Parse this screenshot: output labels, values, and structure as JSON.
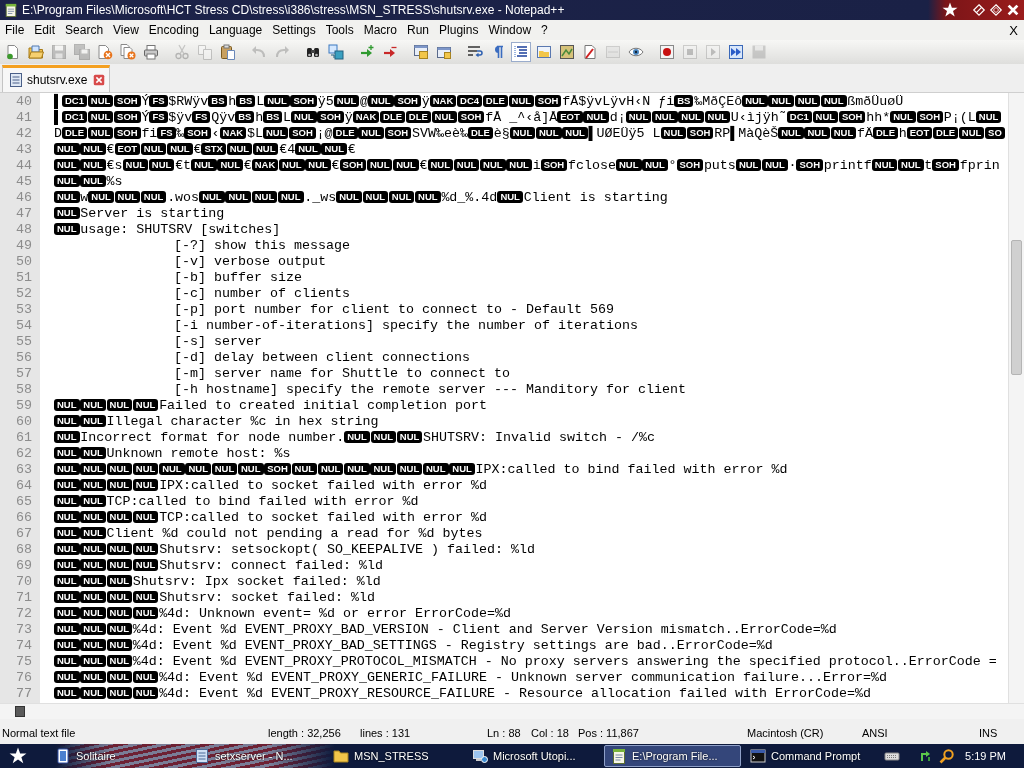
{
  "window": {
    "title": "E:\\Program Files\\Microsoft\\HCT Stress CD\\stress\\i386\\stress\\MSN_STRESS\\shutsrv.exe - Notepad++"
  },
  "menu": {
    "items": [
      "File",
      "Edit",
      "Search",
      "View",
      "Encoding",
      "Language",
      "Settings",
      "Tools",
      "Macro",
      "Run",
      "Plugins",
      "Window",
      "?"
    ],
    "close_document": "X"
  },
  "toolbar": [
    {
      "disabled": false,
      "pressed": false
    },
    {
      "disabled": false,
      "pressed": false
    },
    {
      "disabled": true,
      "pressed": false
    },
    {
      "disabled": true,
      "pressed": false
    },
    {
      "disabled": false,
      "pressed": false
    },
    {
      "disabled": false,
      "pressed": false
    },
    {
      "disabled": false,
      "pressed": false
    },
    {
      "disabled": true,
      "pressed": false
    },
    {
      "disabled": true,
      "pressed": false
    },
    {
      "disabled": false,
      "pressed": false
    },
    {
      "disabled": true,
      "pressed": false
    },
    {
      "disabled": true,
      "pressed": false
    },
    {
      "disabled": false,
      "pressed": false
    },
    {
      "disabled": false,
      "pressed": false
    },
    {
      "disabled": false,
      "pressed": false
    },
    {
      "disabled": false,
      "pressed": false
    },
    {
      "disabled": false,
      "pressed": false
    },
    {
      "disabled": false,
      "pressed": false
    },
    {
      "disabled": false,
      "pressed": false
    },
    {
      "disabled": false,
      "pressed": false
    },
    {
      "disabled": false,
      "pressed": true
    },
    {
      "disabled": false,
      "pressed": false
    },
    {
      "disabled": false,
      "pressed": false
    },
    {
      "disabled": false,
      "pressed": false
    },
    {
      "disabled": true,
      "pressed": false
    },
    {
      "disabled": false,
      "pressed": false
    },
    {
      "disabled": false,
      "pressed": false
    },
    {
      "disabled": true,
      "pressed": false
    },
    {
      "disabled": true,
      "pressed": false
    },
    {
      "disabled": false,
      "pressed": false
    },
    {
      "disabled": true,
      "pressed": false
    }
  ],
  "tabs": [
    {
      "label": "shutsrv.exe",
      "selected": true
    }
  ],
  "editor": {
    "lines": [
      {
        "number": "40",
        "segments": [
          {
            "kind": "text",
            "text": "▌"
          },
          {
            "kind": "ctrl",
            "text": "DC1"
          },
          {
            "kind": "ctrl",
            "text": "NUL"
          },
          {
            "kind": "ctrl",
            "text": "SOH"
          },
          {
            "kind": "text",
            "text": "Ý"
          },
          {
            "kind": "ctrl",
            "text": "FS"
          },
          {
            "kind": "text",
            "text": "$RWÿv"
          },
          {
            "kind": "ctrl",
            "text": "BS"
          },
          {
            "kind": "text",
            "text": "h"
          },
          {
            "kind": "ctrl",
            "text": "BS"
          },
          {
            "kind": "text",
            "text": "L"
          },
          {
            "kind": "ctrl",
            "text": "NUL"
          },
          {
            "kind": "ctrl",
            "text": "SOH"
          },
          {
            "kind": "text",
            "text": "ÿ5"
          },
          {
            "kind": "ctrl",
            "text": "NUL"
          },
          {
            "kind": "text",
            "text": "@"
          },
          {
            "kind": "ctrl",
            "text": "NUL"
          },
          {
            "kind": "ctrl",
            "text": "SOH"
          },
          {
            "kind": "text",
            "text": "ÿ"
          },
          {
            "kind": "ctrl",
            "text": "NAK"
          },
          {
            "kind": "ctrl",
            "text": "DC4"
          },
          {
            "kind": "ctrl",
            "text": "DLE"
          },
          {
            "kind": "ctrl",
            "text": "NUL"
          },
          {
            "kind": "ctrl",
            "text": "SOH"
          },
          {
            "kind": "text",
            "text": "fÅ$ÿvLÿvH‹N ƒi"
          },
          {
            "kind": "ctrl",
            "text": "BS"
          },
          {
            "kind": "text",
            "text": "‰MðÇEô"
          },
          {
            "kind": "ctrl",
            "text": "NUL"
          },
          {
            "kind": "ctrl",
            "text": "NUL"
          },
          {
            "kind": "ctrl",
            "text": "NUL"
          },
          {
            "kind": "ctrl",
            "text": "NUL"
          },
          {
            "kind": "text",
            "text": "ßmðÜuøÜ"
          }
        ]
      },
      {
        "number": "41",
        "segments": [
          {
            "kind": "text",
            "text": "▌"
          },
          {
            "kind": "ctrl",
            "text": "DC1"
          },
          {
            "kind": "ctrl",
            "text": "NUL"
          },
          {
            "kind": "ctrl",
            "text": "SOH"
          },
          {
            "kind": "text",
            "text": "Ý"
          },
          {
            "kind": "ctrl",
            "text": "FS"
          },
          {
            "kind": "text",
            "text": "$ÿv"
          },
          {
            "kind": "ctrl",
            "text": "FS"
          },
          {
            "kind": "text",
            "text": "Qÿv"
          },
          {
            "kind": "ctrl",
            "text": "BS"
          },
          {
            "kind": "text",
            "text": "h"
          },
          {
            "kind": "ctrl",
            "text": "BS"
          },
          {
            "kind": "text",
            "text": "L"
          },
          {
            "kind": "ctrl",
            "text": "NUL"
          },
          {
            "kind": "ctrl",
            "text": "SOH"
          },
          {
            "kind": "text",
            "text": "ÿ"
          },
          {
            "kind": "ctrl",
            "text": "NAK"
          },
          {
            "kind": "ctrl",
            "text": "DLE"
          },
          {
            "kind": "ctrl",
            "text": "DLE"
          },
          {
            "kind": "ctrl",
            "text": "NUL"
          },
          {
            "kind": "ctrl",
            "text": "SOH"
          },
          {
            "kind": "text",
            "text": "fÅ _^‹å]Å"
          },
          {
            "kind": "ctrl",
            "text": "EOT"
          },
          {
            "kind": "ctrl",
            "text": "NUL"
          },
          {
            "kind": "text",
            "text": "d¡"
          },
          {
            "kind": "ctrl",
            "text": "NUL"
          },
          {
            "kind": "ctrl",
            "text": "NUL"
          },
          {
            "kind": "ctrl",
            "text": "NUL"
          },
          {
            "kind": "ctrl",
            "text": "NUL"
          },
          {
            "kind": "text",
            "text": "U‹ìjÿh˜"
          },
          {
            "kind": "ctrl",
            "text": "DC1"
          },
          {
            "kind": "ctrl",
            "text": "NUL"
          },
          {
            "kind": "ctrl",
            "text": "SOH"
          },
          {
            "kind": "text",
            "text": "hh*"
          },
          {
            "kind": "ctrl",
            "text": "NUL"
          },
          {
            "kind": "ctrl",
            "text": "SOH"
          },
          {
            "kind": "text",
            "text": "P¡(L"
          },
          {
            "kind": "ctrl",
            "text": "NUL"
          }
        ]
      },
      {
        "number": "42",
        "segments": [
          {
            "kind": "text",
            "text": "D"
          },
          {
            "kind": "ctrl",
            "text": "DLE"
          },
          {
            "kind": "ctrl",
            "text": "NUL"
          },
          {
            "kind": "ctrl",
            "text": "SOH"
          },
          {
            "kind": "text",
            "text": "fi"
          },
          {
            "kind": "ctrl",
            "text": "FS"
          },
          {
            "kind": "text",
            "text": "‰"
          },
          {
            "kind": "ctrl",
            "text": "SOH"
          },
          {
            "kind": "text",
            "text": "‹"
          },
          {
            "kind": "ctrl",
            "text": "NAK"
          },
          {
            "kind": "text",
            "text": "$L"
          },
          {
            "kind": "ctrl",
            "text": "NUL"
          },
          {
            "kind": "ctrl",
            "text": "SOH"
          },
          {
            "kind": "text",
            "text": "¡@"
          },
          {
            "kind": "ctrl",
            "text": "DLE"
          },
          {
            "kind": "ctrl",
            "text": "NUL"
          },
          {
            "kind": "ctrl",
            "text": "SOH"
          },
          {
            "kind": "text",
            "text": "SVW‰eè‰"
          },
          {
            "kind": "ctrl",
            "text": "DLE"
          },
          {
            "kind": "text",
            "text": "è§"
          },
          {
            "kind": "ctrl",
            "text": "NUL"
          },
          {
            "kind": "ctrl",
            "text": "NUL"
          },
          {
            "kind": "ctrl",
            "text": "NUL"
          },
          {
            "kind": "text",
            "text": "▌UØEÜÿ5 L"
          },
          {
            "kind": "ctrl",
            "text": "NUL"
          },
          {
            "kind": "ctrl",
            "text": "SOH"
          },
          {
            "kind": "text",
            "text": "RP▌MàQèŠ"
          },
          {
            "kind": "ctrl",
            "text": "NUL"
          },
          {
            "kind": "ctrl",
            "text": "NUL"
          },
          {
            "kind": "ctrl",
            "text": "NUL"
          },
          {
            "kind": "text",
            "text": "fÄ"
          },
          {
            "kind": "ctrl",
            "text": "DLE"
          },
          {
            "kind": "text",
            "text": "h"
          },
          {
            "kind": "ctrl",
            "text": "EOT"
          },
          {
            "kind": "ctrl",
            "text": "DLE"
          },
          {
            "kind": "ctrl",
            "text": "NUL"
          },
          {
            "kind": "ctrl",
            "text": "SO"
          }
        ]
      },
      {
        "number": "43",
        "segments": [
          {
            "kind": "ctrl",
            "text": "NUL"
          },
          {
            "kind": "ctrl",
            "text": "NUL"
          },
          {
            "kind": "text",
            "text": "€"
          },
          {
            "kind": "ctrl",
            "text": "EOT"
          },
          {
            "kind": "ctrl",
            "text": "NUL"
          },
          {
            "kind": "ctrl",
            "text": "NUL"
          },
          {
            "kind": "text",
            "text": "€"
          },
          {
            "kind": "ctrl",
            "text": "STX"
          },
          {
            "kind": "ctrl",
            "text": "NUL"
          },
          {
            "kind": "ctrl",
            "text": "NUL"
          },
          {
            "kind": "text",
            "text": "€4"
          },
          {
            "kind": "ctrl",
            "text": "NUL"
          },
          {
            "kind": "ctrl",
            "text": "NUL"
          },
          {
            "kind": "text",
            "text": "€"
          }
        ]
      },
      {
        "number": "44",
        "segments": [
          {
            "kind": "ctrl",
            "text": "NUL"
          },
          {
            "kind": "ctrl",
            "text": "NUL"
          },
          {
            "kind": "text",
            "text": "€s"
          },
          {
            "kind": "ctrl",
            "text": "NUL"
          },
          {
            "kind": "ctrl",
            "text": "NUL"
          },
          {
            "kind": "text",
            "text": "€t"
          },
          {
            "kind": "ctrl",
            "text": "NUL"
          },
          {
            "kind": "ctrl",
            "text": "NUL"
          },
          {
            "kind": "text",
            "text": "€"
          },
          {
            "kind": "ctrl",
            "text": "NAK"
          },
          {
            "kind": "ctrl",
            "text": "NUL"
          },
          {
            "kind": "ctrl",
            "text": "NUL"
          },
          {
            "kind": "text",
            "text": "€"
          },
          {
            "kind": "ctrl",
            "text": "SOH"
          },
          {
            "kind": "ctrl",
            "text": "NUL"
          },
          {
            "kind": "ctrl",
            "text": "NUL"
          },
          {
            "kind": "text",
            "text": "€"
          },
          {
            "kind": "ctrl",
            "text": "NUL"
          },
          {
            "kind": "ctrl",
            "text": "NUL"
          },
          {
            "kind": "ctrl",
            "text": "NUL"
          },
          {
            "kind": "ctrl",
            "text": "NUL"
          },
          {
            "kind": "text",
            "text": "i"
          },
          {
            "kind": "ctrl",
            "text": "SOH"
          },
          {
            "kind": "text",
            "text": "fclose"
          },
          {
            "kind": "ctrl",
            "text": "NUL"
          },
          {
            "kind": "ctrl",
            "text": "NUL"
          },
          {
            "kind": "text",
            "text": "°"
          },
          {
            "kind": "ctrl",
            "text": "SOH"
          },
          {
            "kind": "text",
            "text": "puts"
          },
          {
            "kind": "ctrl",
            "text": "NUL"
          },
          {
            "kind": "ctrl",
            "text": "NUL"
          },
          {
            "kind": "text",
            "text": "·"
          },
          {
            "kind": "ctrl",
            "text": "SOH"
          },
          {
            "kind": "text",
            "text": "printf"
          },
          {
            "kind": "ctrl",
            "text": "NUL"
          },
          {
            "kind": "ctrl",
            "text": "NUL"
          },
          {
            "kind": "text",
            "text": "t"
          },
          {
            "kind": "ctrl",
            "text": "SOH"
          },
          {
            "kind": "text",
            "text": "fprin"
          }
        ]
      },
      {
        "number": "45",
        "segments": [
          {
            "kind": "ctrl",
            "text": "NUL"
          },
          {
            "kind": "ctrl",
            "text": "NUL"
          },
          {
            "kind": "text",
            "text": "%s"
          }
        ]
      },
      {
        "number": "46",
        "segments": [
          {
            "kind": "ctrl",
            "text": "NUL"
          },
          {
            "kind": "text",
            "text": "w"
          },
          {
            "kind": "ctrl",
            "text": "NUL"
          },
          {
            "kind": "ctrl",
            "text": "NUL"
          },
          {
            "kind": "ctrl",
            "text": "NUL"
          },
          {
            "kind": "text",
            "text": ".wos"
          },
          {
            "kind": "ctrl",
            "text": "NUL"
          },
          {
            "kind": "ctrl",
            "text": "NUL"
          },
          {
            "kind": "ctrl",
            "text": "NUL"
          },
          {
            "kind": "ctrl",
            "text": "NUL"
          },
          {
            "kind": "text",
            "text": "._ws"
          },
          {
            "kind": "ctrl",
            "text": "NUL"
          },
          {
            "kind": "ctrl",
            "text": "NUL"
          },
          {
            "kind": "ctrl",
            "text": "NUL"
          },
          {
            "kind": "ctrl",
            "text": "NUL"
          },
          {
            "kind": "text",
            "text": "%d_%.4d"
          },
          {
            "kind": "ctrl",
            "text": "NUL"
          },
          {
            "kind": "text",
            "text": "Client is starting"
          }
        ]
      },
      {
        "number": "47",
        "segments": [
          {
            "kind": "ctrl",
            "text": "NUL"
          },
          {
            "kind": "text",
            "text": "Server is starting"
          }
        ]
      },
      {
        "number": "48",
        "segments": [
          {
            "kind": "ctrl",
            "text": "NUL"
          },
          {
            "kind": "text",
            "text": "usage: SHUTSRV [switches]"
          }
        ]
      },
      {
        "number": "49",
        "segments": [
          {
            "kind": "text",
            "text": "\t\t[-?] show this message"
          }
        ]
      },
      {
        "number": "50",
        "segments": [
          {
            "kind": "text",
            "text": "\t\t[-v] verbose output"
          }
        ]
      },
      {
        "number": "51",
        "segments": [
          {
            "kind": "text",
            "text": "\t\t[-b] buffer size"
          }
        ]
      },
      {
        "number": "52",
        "segments": [
          {
            "kind": "text",
            "text": "\t\t[-c] number of clients"
          }
        ]
      },
      {
        "number": "53",
        "segments": [
          {
            "kind": "text",
            "text": "\t\t[-p] port number for client to connect to - Default 569"
          }
        ]
      },
      {
        "number": "54",
        "segments": [
          {
            "kind": "text",
            "text": "\t\t[-i number-of-iterations] specify the number of iterations"
          }
        ]
      },
      {
        "number": "55",
        "segments": [
          {
            "kind": "text",
            "text": "\t\t[-s] server"
          }
        ]
      },
      {
        "number": "56",
        "segments": [
          {
            "kind": "text",
            "text": "\t\t[-d] delay between client connections"
          }
        ]
      },
      {
        "number": "57",
        "segments": [
          {
            "kind": "text",
            "text": "\t\t[-m] server name for Shuttle to connect to"
          }
        ]
      },
      {
        "number": "58",
        "segments": [
          {
            "kind": "text",
            "text": "\t\t[-h hostname] specify the remote server --- Manditory for client"
          }
        ]
      },
      {
        "number": "59",
        "segments": [
          {
            "kind": "ctrl",
            "text": "NUL"
          },
          {
            "kind": "ctrl",
            "text": "NUL"
          },
          {
            "kind": "ctrl",
            "text": "NUL"
          },
          {
            "kind": "ctrl",
            "text": "NUL"
          },
          {
            "kind": "text",
            "text": "Failed to created initial completion port"
          }
        ]
      },
      {
        "number": "60",
        "segments": [
          {
            "kind": "ctrl",
            "text": "NUL"
          },
          {
            "kind": "ctrl",
            "text": "NUL"
          },
          {
            "kind": "text",
            "text": "Illegal character %c in hex string"
          }
        ]
      },
      {
        "number": "61",
        "segments": [
          {
            "kind": "ctrl",
            "text": "NUL"
          },
          {
            "kind": "text",
            "text": "Incorrect format for node number."
          },
          {
            "kind": "ctrl",
            "text": "NUL"
          },
          {
            "kind": "ctrl",
            "text": "NUL"
          },
          {
            "kind": "ctrl",
            "text": "NUL"
          },
          {
            "kind": "text",
            "text": "SHUTSRV: Invalid switch - /%c"
          }
        ]
      },
      {
        "number": "62",
        "segments": [
          {
            "kind": "ctrl",
            "text": "NUL"
          },
          {
            "kind": "ctrl",
            "text": "NUL"
          },
          {
            "kind": "text",
            "text": "Unknown remote host: %s"
          }
        ]
      },
      {
        "number": "63",
        "segments": [
          {
            "kind": "ctrl",
            "text": "NUL"
          },
          {
            "kind": "ctrl",
            "text": "NUL"
          },
          {
            "kind": "ctrl",
            "text": "NUL"
          },
          {
            "kind": "ctrl",
            "text": "NUL"
          },
          {
            "kind": "ctrl",
            "text": "NUL"
          },
          {
            "kind": "ctrl",
            "text": "NUL"
          },
          {
            "kind": "ctrl",
            "text": "NUL"
          },
          {
            "kind": "ctrl",
            "text": "NUL"
          },
          {
            "kind": "ctrl",
            "text": "SOH"
          },
          {
            "kind": "ctrl",
            "text": "NUL"
          },
          {
            "kind": "ctrl",
            "text": "NUL"
          },
          {
            "kind": "ctrl",
            "text": "NUL"
          },
          {
            "kind": "ctrl",
            "text": "NUL"
          },
          {
            "kind": "ctrl",
            "text": "NUL"
          },
          {
            "kind": "ctrl",
            "text": "NUL"
          },
          {
            "kind": "ctrl",
            "text": "NUL"
          },
          {
            "kind": "text",
            "text": "IPX:called to bind failed with error %d"
          }
        ]
      },
      {
        "number": "64",
        "segments": [
          {
            "kind": "ctrl",
            "text": "NUL"
          },
          {
            "kind": "ctrl",
            "text": "NUL"
          },
          {
            "kind": "ctrl",
            "text": "NUL"
          },
          {
            "kind": "ctrl",
            "text": "NUL"
          },
          {
            "kind": "text",
            "text": "IPX:called to socket failed with error %d"
          }
        ]
      },
      {
        "number": "65",
        "segments": [
          {
            "kind": "ctrl",
            "text": "NUL"
          },
          {
            "kind": "ctrl",
            "text": "NUL"
          },
          {
            "kind": "text",
            "text": "TCP:called to bind failed with error %d"
          }
        ]
      },
      {
        "number": "66",
        "segments": [
          {
            "kind": "ctrl",
            "text": "NUL"
          },
          {
            "kind": "ctrl",
            "text": "NUL"
          },
          {
            "kind": "ctrl",
            "text": "NUL"
          },
          {
            "kind": "ctrl",
            "text": "NUL"
          },
          {
            "kind": "text",
            "text": "TCP:called to socket failed with error %d"
          }
        ]
      },
      {
        "number": "67",
        "segments": [
          {
            "kind": "ctrl",
            "text": "NUL"
          },
          {
            "kind": "ctrl",
            "text": "NUL"
          },
          {
            "kind": "text",
            "text": "Client %d could not pending a read for %d bytes"
          }
        ]
      },
      {
        "number": "68",
        "segments": [
          {
            "kind": "ctrl",
            "text": "NUL"
          },
          {
            "kind": "ctrl",
            "text": "NUL"
          },
          {
            "kind": "ctrl",
            "text": "NUL"
          },
          {
            "kind": "ctrl",
            "text": "NUL"
          },
          {
            "kind": "text",
            "text": "Shutsrv: setsockopt( SO_KEEPALIVE ) failed: %ld"
          }
        ]
      },
      {
        "number": "69",
        "segments": [
          {
            "kind": "ctrl",
            "text": "NUL"
          },
          {
            "kind": "ctrl",
            "text": "NUL"
          },
          {
            "kind": "ctrl",
            "text": "NUL"
          },
          {
            "kind": "ctrl",
            "text": "NUL"
          },
          {
            "kind": "text",
            "text": "Shutsrv: connect failed: %ld"
          }
        ]
      },
      {
        "number": "70",
        "segments": [
          {
            "kind": "ctrl",
            "text": "NUL"
          },
          {
            "kind": "ctrl",
            "text": "NUL"
          },
          {
            "kind": "ctrl",
            "text": "NUL"
          },
          {
            "kind": "text",
            "text": "Shutsrv: Ipx socket failed: %ld"
          }
        ]
      },
      {
        "number": "71",
        "segments": [
          {
            "kind": "ctrl",
            "text": "NUL"
          },
          {
            "kind": "ctrl",
            "text": "NUL"
          },
          {
            "kind": "ctrl",
            "text": "NUL"
          },
          {
            "kind": "ctrl",
            "text": "NUL"
          },
          {
            "kind": "text",
            "text": "Shutsrv: socket failed: %ld"
          }
        ]
      },
      {
        "number": "72",
        "segments": [
          {
            "kind": "ctrl",
            "text": "NUL"
          },
          {
            "kind": "ctrl",
            "text": "NUL"
          },
          {
            "kind": "ctrl",
            "text": "NUL"
          },
          {
            "kind": "ctrl",
            "text": "NUL"
          },
          {
            "kind": "text",
            "text": "%4d: Unknown event= %d or error ErrorCode=%d"
          }
        ]
      },
      {
        "number": "73",
        "segments": [
          {
            "kind": "ctrl",
            "text": "NUL"
          },
          {
            "kind": "ctrl",
            "text": "NUL"
          },
          {
            "kind": "ctrl",
            "text": "NUL"
          },
          {
            "kind": "text",
            "text": "%4d: Event %d EVENT_PROXY_BAD_VERSION - Client and Server Version mismatch..ErrorCode=%d"
          }
        ]
      },
      {
        "number": "74",
        "segments": [
          {
            "kind": "ctrl",
            "text": "NUL"
          },
          {
            "kind": "ctrl",
            "text": "NUL"
          },
          {
            "kind": "ctrl",
            "text": "NUL"
          },
          {
            "kind": "text",
            "text": "%4d: Event %d EVENT_PROXY_BAD_SETTINGS - Registry settings are bad..ErrorCode=%d"
          }
        ]
      },
      {
        "number": "75",
        "segments": [
          {
            "kind": "ctrl",
            "text": "NUL"
          },
          {
            "kind": "ctrl",
            "text": "NUL"
          },
          {
            "kind": "ctrl",
            "text": "NUL"
          },
          {
            "kind": "text",
            "text": "%4d: Event %d EVENT_PROXY_PROTOCOL_MISMATCH - No proxy servers answering the specified protocol..ErrorCode ="
          }
        ]
      },
      {
        "number": "76",
        "segments": [
          {
            "kind": "ctrl",
            "text": "NUL"
          },
          {
            "kind": "ctrl",
            "text": "NUL"
          },
          {
            "kind": "ctrl",
            "text": "NUL"
          },
          {
            "kind": "ctrl",
            "text": "NUL"
          },
          {
            "kind": "text",
            "text": "%4d: Event %d EVENT_PROXY_GENERIC_FAILURE - Unknown server communication failure...Error=%d"
          }
        ]
      },
      {
        "number": "77",
        "segments": [
          {
            "kind": "ctrl",
            "text": "NUL"
          },
          {
            "kind": "ctrl",
            "text": "NUL"
          },
          {
            "kind": "ctrl",
            "text": "NUL"
          },
          {
            "kind": "ctrl",
            "text": "NUL"
          },
          {
            "kind": "text",
            "text": "%4d: Event %d EVENT_PROXY_RESOURCE_FAILURE - Resource allocation failed with ErrorCode=%d"
          }
        ]
      }
    ]
  },
  "status_bar": {
    "document_type": "Normal text file",
    "length": "length : 32,256",
    "lines": "lines : 131",
    "line": "Ln : 88",
    "column": "Col : 18",
    "position": "Pos : 11,867",
    "line_ending": "Macintosh (CR)",
    "encoding": "ANSI",
    "mode": "INS"
  },
  "taskbar": {
    "tasks": [
      {
        "label": "Solitaire",
        "selected": false
      },
      {
        "label": "setxserver - N...",
        "selected": false
      },
      {
        "label": "MSN_STRESS",
        "selected": false
      },
      {
        "label": "Microsoft Utopi...",
        "selected": false
      },
      {
        "label": "E:\\Program File...",
        "selected": true
      },
      {
        "label": "Command Prompt",
        "selected": false
      }
    ],
    "clock": "5:19 PM"
  }
}
